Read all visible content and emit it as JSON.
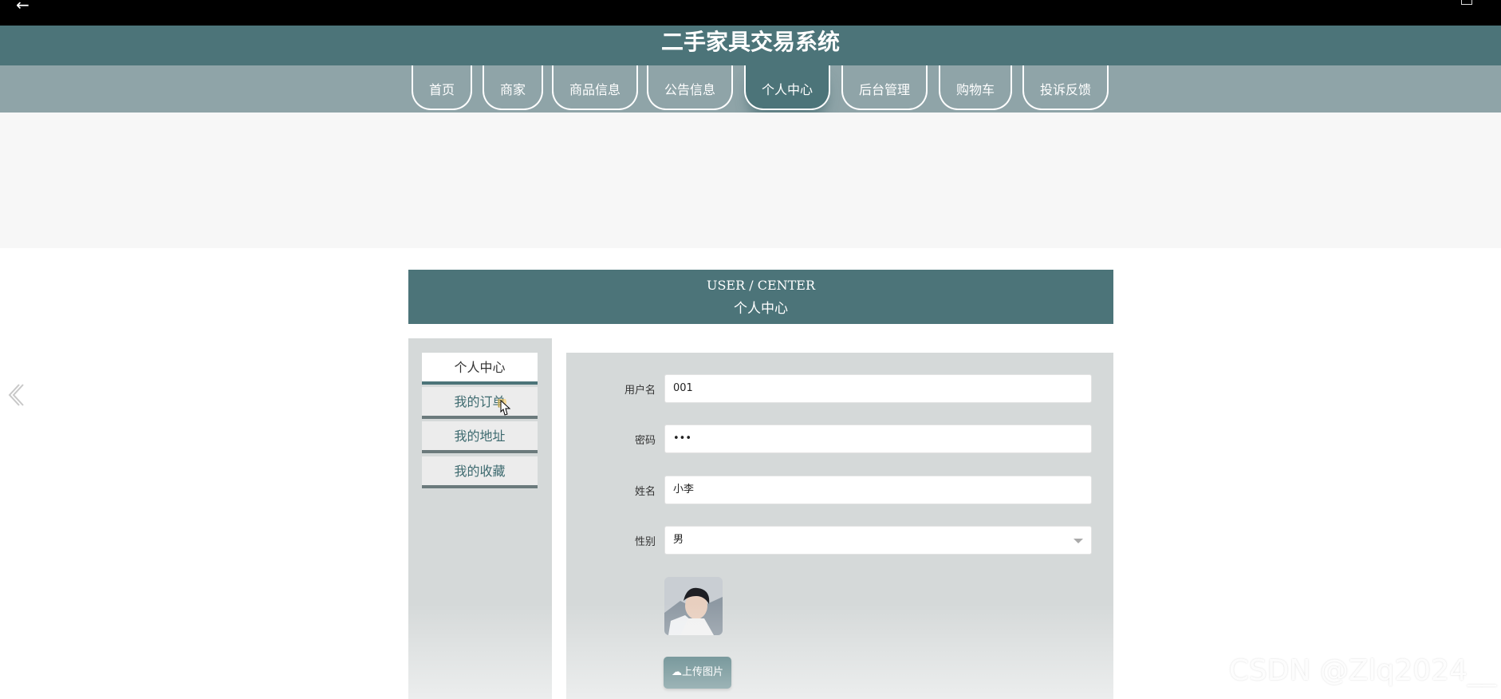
{
  "site": {
    "title": "二手家具交易系统"
  },
  "nav": {
    "items": [
      {
        "label": "首页"
      },
      {
        "label": "商家"
      },
      {
        "label": "商品信息"
      },
      {
        "label": "公告信息"
      },
      {
        "label": "个人中心",
        "active": true
      },
      {
        "label": "后台管理"
      },
      {
        "label": "购物车"
      },
      {
        "label": "投诉反馈"
      }
    ]
  },
  "center": {
    "title_en": "USER / CENTER",
    "title_cn": "个人中心"
  },
  "sidebar": {
    "items": [
      {
        "label": "个人中心",
        "active": true
      },
      {
        "label": "我的订单"
      },
      {
        "label": "我的地址"
      },
      {
        "label": "我的收藏"
      }
    ]
  },
  "form": {
    "username": {
      "label": "用户名",
      "value": "001"
    },
    "password": {
      "label": "密码",
      "value": "•••"
    },
    "name": {
      "label": "姓名",
      "value": "小李"
    },
    "gender": {
      "label": "性别",
      "value": "男"
    },
    "upload_label": "上传图片"
  },
  "watermark": "CSDN @Zlq2024__",
  "colors": {
    "primary": "#4c7479",
    "nav_bg": "#8fa4a8",
    "panel_bg": "#d5d9d9"
  },
  "icons": {
    "back": "arrow-left-icon",
    "prev": "chevron-left-icon",
    "upload": "cloud-upload-icon",
    "select": "caret-down-icon"
  }
}
